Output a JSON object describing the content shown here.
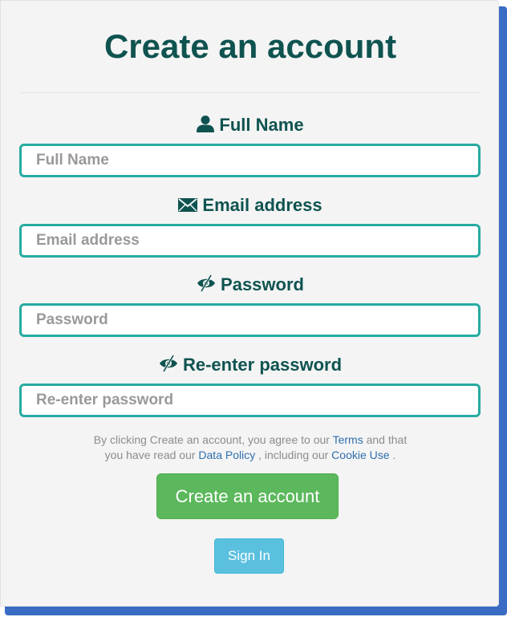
{
  "form": {
    "title": "Create an account",
    "fields": [
      {
        "label": "Full Name",
        "icon": "user-icon",
        "placeholder": "Full Name",
        "value": ""
      },
      {
        "label": "Email address",
        "icon": "envelope-icon",
        "placeholder": "Email address",
        "value": ""
      },
      {
        "label": "Password",
        "icon": "eye-slash-icon",
        "placeholder": "Password",
        "value": ""
      },
      {
        "label": "Re-enter password",
        "icon": "eye-slash-icon",
        "placeholder": "Re-enter password",
        "value": ""
      }
    ],
    "legal": {
      "text_1": "By clicking Create an account, you agree to our",
      "terms_link": "Terms",
      "text_2": "and that",
      "text_3": "you have read our",
      "data_policy_link": "Data Policy",
      "text_4": ", including our",
      "cookie_link": "Cookie Use",
      "text_5": "."
    },
    "create_button": "Create an account",
    "signin_button": "Sign In"
  },
  "colors": {
    "heading": "#0f5350",
    "input_border": "#26aba1",
    "create_button": "#5cb85c",
    "signin_button": "#5bc0de",
    "link": "#2f6fb0",
    "card_shadow": "#3a6cc4"
  }
}
